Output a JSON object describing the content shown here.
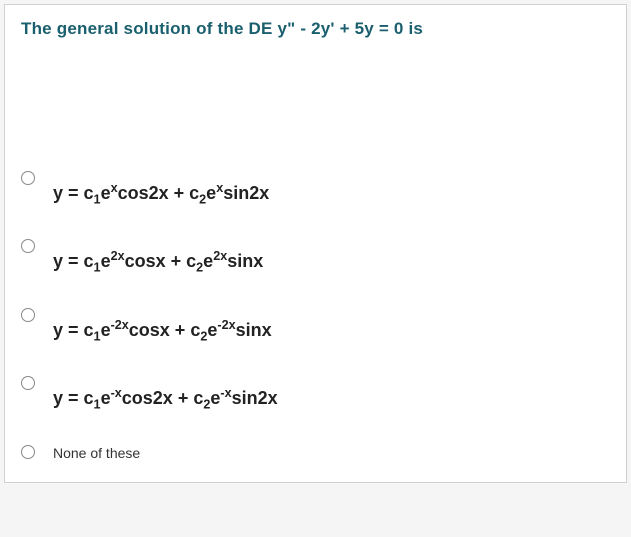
{
  "question": "The general solution of the DE y\" - 2y' + 5y = 0 is",
  "options": [
    {
      "html": "y = c<sub>1</sub>e<sup>x</sup>cos2x + c<sub>2</sub>e<sup>x</sup>sin2x"
    },
    {
      "html": "y = c<sub>1</sub>e<sup>2x</sup>cosx + c<sub>2</sub>e<sup>2x</sup>sinx"
    },
    {
      "html": "y = c<sub>1</sub>e<sup>-2x</sup>cosx + c<sub>2</sub>e<sup>-2x</sup>sinx"
    },
    {
      "html": "y = c<sub>1</sub>e<sup>-x</sup>cos2x + c<sub>2</sub>e<sup>-x</sup>sin2x"
    },
    {
      "text": "None of these"
    }
  ]
}
